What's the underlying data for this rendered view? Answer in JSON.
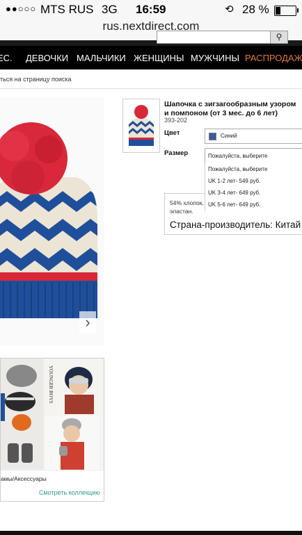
{
  "status_bar": {
    "signal": "●●○○○",
    "carrier": "MTS RUS",
    "network": "3G",
    "time": "16:59",
    "battery": "28 %",
    "battery_level": 0.28
  },
  "browser": {
    "url": "rus.nextdirect.com"
  },
  "nav": {
    "items": [
      "ЕС.",
      "ДЕВОЧКИ",
      "МАЛЬЧИКИ",
      "ЖЕНЩИНЫ",
      "МУЖЧИНЫ",
      "РАСПРОДАЖА"
    ]
  },
  "breadcrumb": {
    "back_text": "ться на страницу поиска"
  },
  "product": {
    "title": "Шапочка с зигзагообразным узором и помпоном (от 3 мес. до 6 лет)",
    "code": "393-202",
    "color_label": "Цвет",
    "color_value": "Синий",
    "size_label": "Размер",
    "size_placeholder": "Пожалуйста, выберите",
    "size_options": [
      "Пожалуйста, выберите",
      "UK 1-2 лет- 549 руб.",
      "UK 3-4 лет- 649 руб.",
      "UK 5-6 лет- 649 руб."
    ],
    "composition": "54% хлопок, эластан.",
    "origin": "Страна-производитель: Китай"
  },
  "collection": {
    "caption": "амы/Аксессуары",
    "link": "Смотреть коллекцию",
    "magazine_text": "YOUNGER BOYS"
  },
  "colors": {
    "nav_bg": "#000000",
    "sale": "#e07a3a",
    "link": "#2a9a8a",
    "hat_red": "#d8283a",
    "hat_blue": "#1f4f9a"
  }
}
